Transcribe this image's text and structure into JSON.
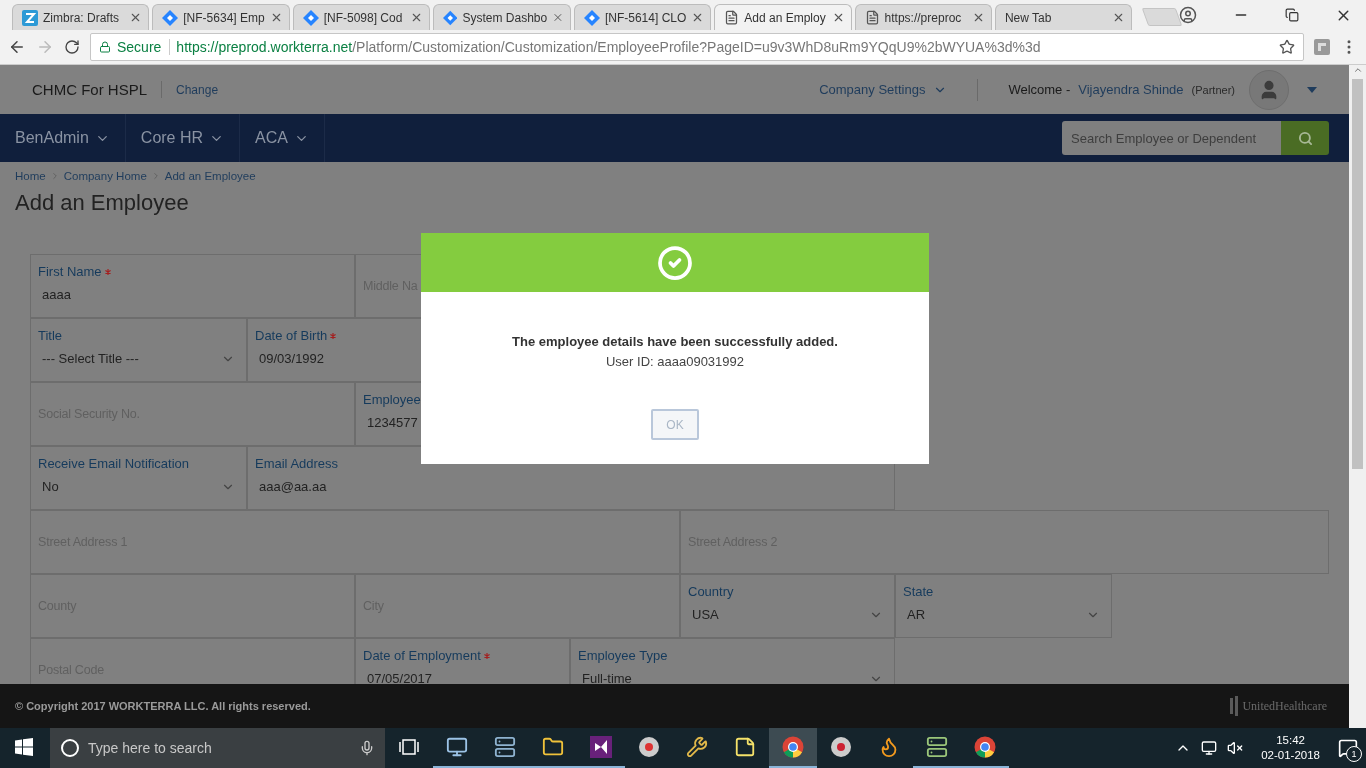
{
  "browser": {
    "tabs": [
      {
        "title": "Zimbra: Drafts",
        "kind": "letter",
        "selected": false
      },
      {
        "title": "[NF-5634] Emp",
        "kind": "diamond",
        "selected": false
      },
      {
        "title": "[NF-5098] Cod",
        "kind": "diamond",
        "selected": false
      },
      {
        "title": "System Dashbo",
        "kind": "diamond",
        "selected": false
      },
      {
        "title": "[NF-5614] CLO",
        "kind": "diamond",
        "selected": false
      },
      {
        "title": "Add an Employ",
        "kind": "page",
        "selected": true
      },
      {
        "title": "https://preproc",
        "kind": "page",
        "selected": false
      },
      {
        "title": "New Tab",
        "kind": "plain",
        "selected": false
      }
    ],
    "secure_label": "Secure",
    "url_host": "https://preprod.workterra.net",
    "url_path": "/Platform/Customization/Customization/EmployeeProfile?PageID=u9v3WhD8uRm9YQqU9%2bWYUA%3d%3d"
  },
  "header": {
    "company": "CHMC For HSPL",
    "change_link": "Change",
    "company_settings": "Company Settings",
    "welcome": "Welcome -",
    "user_name": "Vijayendra Shinde",
    "role": "(Partner)"
  },
  "nav": {
    "items": [
      "BenAdmin",
      "Core HR",
      "ACA"
    ],
    "search": {
      "placeholder": "Search Employee or Dependent"
    }
  },
  "breadcrumb": [
    "Home",
    "Company Home",
    "Add an Employee"
  ],
  "page_title": "Add an Employee",
  "form_rows": [
    [
      {
        "kind": "text",
        "label": "First Name",
        "required": true,
        "value": "aaaa"
      },
      {
        "kind": "text",
        "placeholder": "Middle Na"
      }
    ],
    [
      {
        "kind": "select",
        "label": "Title",
        "required": false,
        "value": "--- Select Title ---"
      },
      {
        "kind": "text",
        "label": "Date of Birth",
        "required": true,
        "value": "09/03/1992"
      }
    ],
    [
      {
        "kind": "text",
        "placeholder": "Social Security No."
      },
      {
        "kind": "text",
        "label": "Employee",
        "value": "1234577"
      }
    ],
    [
      {
        "kind": "select",
        "label": "Receive Email Notification",
        "required": false,
        "value": "No"
      },
      {
        "kind": "text",
        "label": "Email Address",
        "required": false,
        "value": "aaa@aa.aa"
      }
    ],
    [
      {
        "kind": "text",
        "placeholder": "Street Address 1"
      },
      {
        "kind": "text",
        "placeholder": "Street Address 2"
      }
    ],
    [
      {
        "kind": "text",
        "placeholder": "County"
      },
      {
        "kind": "text",
        "placeholder": "City"
      },
      {
        "kind": "select",
        "label": "Country",
        "required": false,
        "value": "USA"
      },
      {
        "kind": "select",
        "label": "State",
        "required": false,
        "value": "AR"
      }
    ],
    [
      {
        "kind": "text",
        "placeholder": "Postal Code"
      },
      {
        "kind": "text",
        "label": "Date of Employment",
        "required": true,
        "value": "07/05/2017"
      },
      {
        "kind": "select",
        "label": "Employee Type",
        "required": false,
        "value": "Full-time"
      }
    ]
  ],
  "dialog": {
    "message": "The employee details have been successfully added.",
    "detail": "User ID: aaaa09031992",
    "button": "OK"
  },
  "footer": {
    "copyright": "© Copyright 2017 WORKTERRA LLC. All rights reserved.",
    "brand": "UnitedHealthcare"
  },
  "taskbar": {
    "search_placeholder": "Type here to search",
    "time": "15:42",
    "date": "02-01-2018",
    "notifications": "1"
  }
}
